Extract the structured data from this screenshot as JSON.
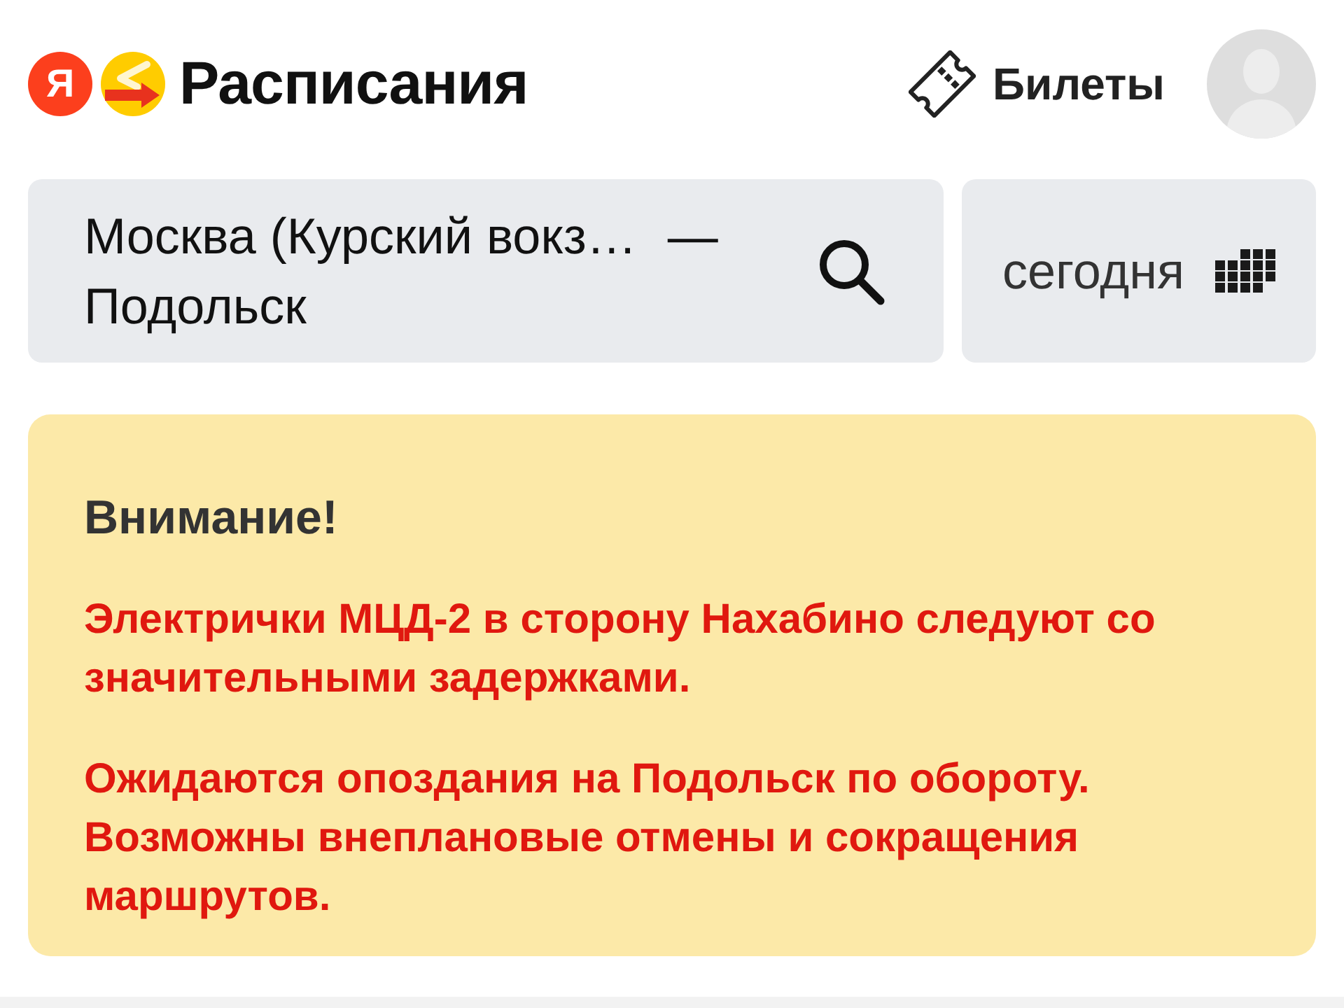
{
  "header": {
    "logo_letter": "Я",
    "title": "Расписания",
    "tickets_link": "Билеты"
  },
  "search": {
    "from": "Москва (Курский вокз…",
    "separator": "—",
    "to": "Подольск"
  },
  "date_button": {
    "label": "сегодня"
  },
  "alert": {
    "title": "Внимание!",
    "paragraphs": [
      "Электрички МЦД-2 в сторону Нахабино следуют со значительными задержками.",
      "Ожидаются опоздания на Подольск по обороту. Возможны внеплановые отмены и сокращения маршрутов."
    ]
  }
}
